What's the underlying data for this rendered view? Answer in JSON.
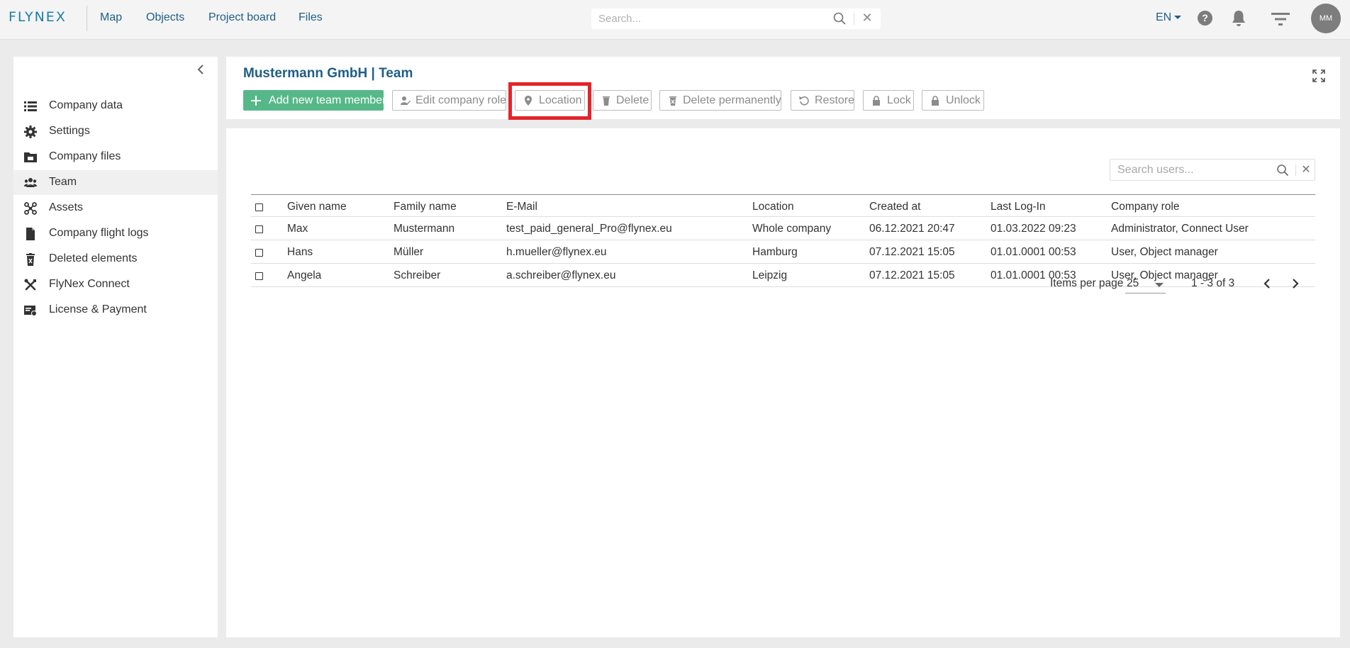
{
  "app": {
    "logo_text": "FLYNEX"
  },
  "topnav": {
    "items": [
      {
        "label": "Map"
      },
      {
        "label": "Objects"
      },
      {
        "label": "Project board"
      },
      {
        "label": "Files"
      }
    ],
    "search_placeholder": "Search...",
    "clear_symbol": "✕",
    "language": "EN",
    "help_symbol": "?",
    "avatar_initials": "MM"
  },
  "sidebar": {
    "items": [
      {
        "label": "Company data",
        "icon": "list-icon"
      },
      {
        "label": "Settings",
        "icon": "gear-icon"
      },
      {
        "label": "Company files",
        "icon": "folder-icon"
      },
      {
        "label": "Team",
        "icon": "users-icon",
        "active": true
      },
      {
        "label": "Assets",
        "icon": "drone-icon"
      },
      {
        "label": "Company flight logs",
        "icon": "file-icon"
      },
      {
        "label": "Deleted elements",
        "icon": "trash-icon"
      },
      {
        "label": "FlyNex Connect",
        "icon": "tools-icon"
      },
      {
        "label": "License & Payment",
        "icon": "license-icon"
      }
    ]
  },
  "header": {
    "title": "Mustermann GmbH | Team",
    "buttons": {
      "add": "Add new team member",
      "edit_role": "Edit company role",
      "location": "Location",
      "delete": "Delete",
      "delete_permanently": "Delete permanently",
      "restore": "Restore",
      "lock": "Lock",
      "unlock": "Unlock"
    }
  },
  "users_table": {
    "search_placeholder": "Search users...",
    "clear_symbol": "✕",
    "columns": {
      "given_name": "Given name",
      "family_name": "Family name",
      "email": "E-Mail",
      "location": "Location",
      "created_at": "Created at",
      "last_login": "Last Log-In",
      "company_role": "Company role"
    },
    "rows": [
      {
        "given_name": "Max",
        "family_name": "Mustermann",
        "email": "test_paid_general_Pro@flynex.eu",
        "location": "Whole company",
        "created_at": "06.12.2021 20:47",
        "last_login": "01.03.2022 09:23",
        "company_role": "Administrator, Connect User"
      },
      {
        "given_name": "Hans",
        "family_name": "Müller",
        "email": "h.mueller@flynex.eu",
        "location": "Hamburg",
        "created_at": "07.12.2021 15:05",
        "last_login": "01.01.0001 00:53",
        "company_role": "User, Object manager"
      },
      {
        "given_name": "Angela",
        "family_name": "Schreiber",
        "email": "a.schreiber@flynex.eu",
        "location": "Leipzig",
        "created_at": "07.12.2021 15:05",
        "last_login": "01.01.0001 00:53",
        "company_role": "User, Object manager"
      }
    ]
  },
  "pagination": {
    "items_per_page_label": "Items per page",
    "items_per_page_value": "25",
    "range_text": "1 - 3 of 3"
  },
  "colors": {
    "brand": "#1e7fa6",
    "nav_text": "#1f5f85",
    "primary_button": "#56b889",
    "highlight": "#e2252b"
  }
}
